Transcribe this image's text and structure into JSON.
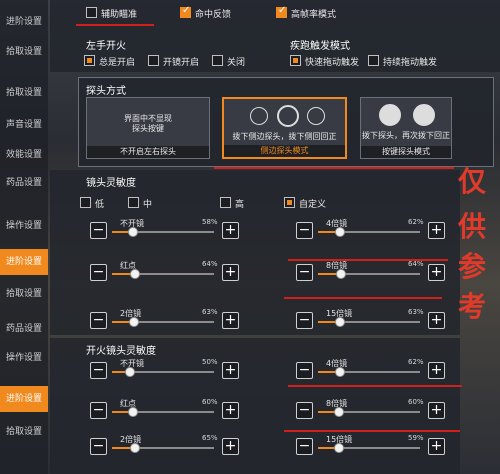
{
  "colors": {
    "accent": "#f08a1f",
    "annotation": "#d0201c"
  },
  "top": {
    "options": [
      {
        "label": "辅助瞄准",
        "checked": false
      },
      {
        "label": "命中反馈",
        "checked": true
      },
      {
        "label": "高帧率模式",
        "checked": true
      }
    ]
  },
  "sidebar": {
    "items": [
      "进阶设置",
      "拾取设置",
      "拾取设置",
      "声音设置",
      "效能设置",
      "药品设置",
      "操作设置",
      "进阶设置",
      "拾取设置",
      "药品设置",
      "操作设置",
      "进阶设置",
      "拾取设置"
    ]
  },
  "left_fire": {
    "title": "左手开火",
    "options": [
      "总是开启",
      "开镜开启",
      "关闭"
    ]
  },
  "sprint": {
    "title": "疾跑触发模式",
    "options": [
      "快速拖动触发",
      "持续拖动触发"
    ]
  },
  "peek": {
    "title": "探头方式",
    "cards": [
      {
        "inner": "界面中不显现\n探头按键",
        "caption": "不开启左右探头"
      },
      {
        "inner": "拨下侧边探头，拨下侧回回正",
        "caption": "侧边探头模式"
      },
      {
        "inner": "拨下探头，再次拨下回正",
        "caption": "按键探头模式"
      }
    ]
  },
  "scope": {
    "title": "镜头灵敏度",
    "levels": [
      "低",
      "中",
      "高",
      "自定义"
    ],
    "sliders": [
      {
        "name": "不开镜",
        "pct": "58%",
        "value": 0.58
      },
      {
        "name": "4倍镜",
        "pct": "62%",
        "value": 0.62
      },
      {
        "name": "红点",
        "pct": "64%",
        "value": 0.64
      },
      {
        "name": "8倍镜",
        "pct": "64%",
        "value": 0.64
      },
      {
        "name": "2倍镜",
        "pct": "63%",
        "value": 0.63
      },
      {
        "name": "15倍镜",
        "pct": "63%",
        "value": 0.63
      }
    ]
  },
  "ads": {
    "title": "开火镜头灵敏度",
    "sliders": [
      {
        "name": "不开镜",
        "pct": "50%",
        "value": 0.5
      },
      {
        "name": "4倍镜",
        "pct": "62%",
        "value": 0.62
      },
      {
        "name": "红点",
        "pct": "60%",
        "value": 0.6
      },
      {
        "name": "8倍镜",
        "pct": "60%",
        "value": 0.6
      },
      {
        "name": "2倍镜",
        "pct": "65%",
        "value": 0.65
      },
      {
        "name": "15倍镜",
        "pct": "59%",
        "value": 0.59
      }
    ]
  },
  "watermark": [
    "仅",
    "供",
    "参",
    "考"
  ],
  "buttons": {
    "minus": "−",
    "plus": "+"
  }
}
